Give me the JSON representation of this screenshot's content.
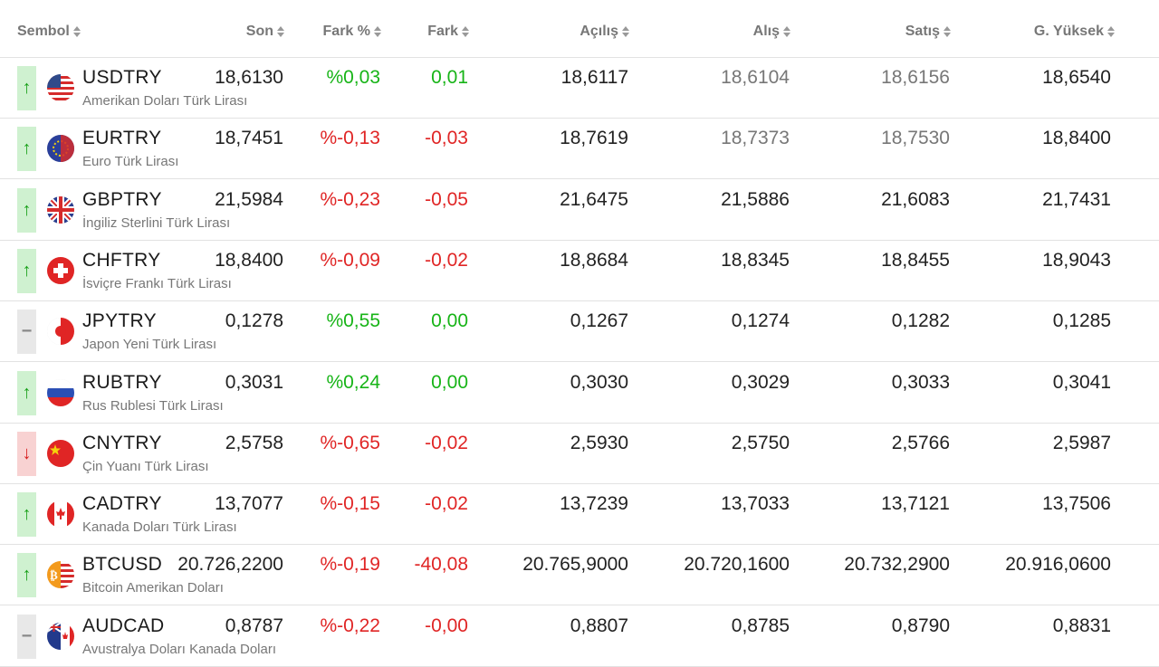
{
  "headers": {
    "symbol": "Sembol",
    "last": "Son",
    "change_pct": "Fark %",
    "change": "Fark",
    "open": "Açılış",
    "bid": "Alış",
    "ask": "Satış",
    "high": "G. Yüksek"
  },
  "colors": {
    "positive": "#17b417",
    "negative": "#e02525",
    "up_bg": "#cff1d0",
    "down_bg": "#f8d2d2",
    "flat_bg": "#e8e8e8"
  },
  "rows": [
    {
      "code": "USDTRY",
      "name": "Amerikan Doları Türk Lirası",
      "trend": "up",
      "trend_icon": "↑",
      "flag": "us-flag-icon",
      "last": "18,6130",
      "change_pct": "%0,03",
      "change": "0,01",
      "open": "18,6117",
      "bid": "18,6104",
      "ask": "18,6156",
      "high": "18,6540"
    },
    {
      "code": "EURTRY",
      "name": "Euro Türk Lirası",
      "trend": "up",
      "trend_icon": "↑",
      "flag": "eu-flag-icon",
      "last": "18,7451",
      "change_pct": "%-0,13",
      "change": "-0,03",
      "open": "18,7619",
      "bid": "18,7373",
      "ask": "18,7530",
      "high": "18,8400"
    },
    {
      "code": "GBPTRY",
      "name": "İngiliz Sterlini Türk Lirası",
      "trend": "up",
      "trend_icon": "↑",
      "flag": "uk-flag-icon",
      "last": "21,5984",
      "change_pct": "%-0,23",
      "change": "-0,05",
      "open": "21,6475",
      "bid": "21,5886",
      "ask": "21,6083",
      "high": "21,7431"
    },
    {
      "code": "CHFTRY",
      "name": "İsviçre Frankı Türk Lirası",
      "trend": "up",
      "trend_icon": "↑",
      "flag": "ch-flag-icon",
      "last": "18,8400",
      "change_pct": "%-0,09",
      "change": "-0,02",
      "open": "18,8684",
      "bid": "18,8345",
      "ask": "18,8455",
      "high": "18,9043"
    },
    {
      "code": "JPYTRY",
      "name": "Japon Yeni Türk Lirası",
      "trend": "flat",
      "trend_icon": "−",
      "flag": "jp-flag-icon",
      "last": "0,1278",
      "change_pct": "%0,55",
      "change": "0,00",
      "open": "0,1267",
      "bid": "0,1274",
      "ask": "0,1282",
      "high": "0,1285"
    },
    {
      "code": "RUBTRY",
      "name": "Rus Rublesi Türk Lirası",
      "trend": "up",
      "trend_icon": "↑",
      "flag": "ru-flag-icon",
      "last": "0,3031",
      "change_pct": "%0,24",
      "change": "0,00",
      "open": "0,3030",
      "bid": "0,3029",
      "ask": "0,3033",
      "high": "0,3041"
    },
    {
      "code": "CNYTRY",
      "name": "Çin Yuanı Türk Lirası",
      "trend": "down",
      "trend_icon": "↓",
      "flag": "cn-flag-icon",
      "last": "2,5758",
      "change_pct": "%-0,65",
      "change": "-0,02",
      "open": "2,5930",
      "bid": "2,5750",
      "ask": "2,5766",
      "high": "2,5987"
    },
    {
      "code": "CADTRY",
      "name": "Kanada Doları Türk Lirası",
      "trend": "up",
      "trend_icon": "↑",
      "flag": "ca-flag-icon",
      "last": "13,7077",
      "change_pct": "%-0,15",
      "change": "-0,02",
      "open": "13,7239",
      "bid": "13,7033",
      "ask": "13,7121",
      "high": "13,7506"
    },
    {
      "code": "BTCUSD",
      "name": "Bitcoin Amerikan Doları",
      "trend": "up",
      "trend_icon": "↑",
      "flag": "btc-us-flag-icon",
      "last": "20.726,2200",
      "change_pct": "%-0,19",
      "change": "-40,08",
      "open": "20.765,9000",
      "bid": "20.720,1600",
      "ask": "20.732,2900",
      "high": "20.916,0600"
    },
    {
      "code": "AUDCAD",
      "name": "Avustralya Doları Kanada Doları",
      "trend": "flat",
      "trend_icon": "−",
      "flag": "au-ca-flag-icon",
      "last": "0,8787",
      "change_pct": "%-0,22",
      "change": "-0,00",
      "open": "0,8807",
      "bid": "0,8785",
      "ask": "0,8790",
      "high": "0,8831"
    }
  ]
}
